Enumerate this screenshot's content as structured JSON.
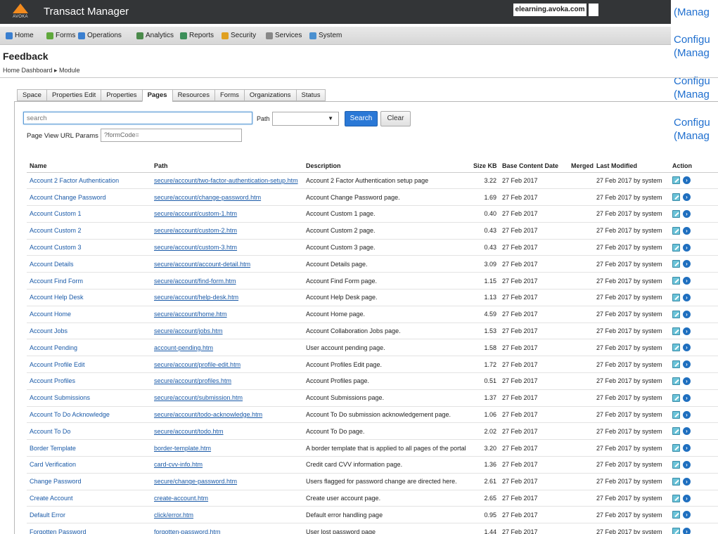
{
  "header": {
    "logo_text": "AVOKA",
    "app_title": "Transact Manager",
    "host": "elearning.avoka.com"
  },
  "menu": [
    {
      "label": "Home",
      "icon": "home-icon",
      "color": "#3a7fd0"
    },
    {
      "label": "Forms",
      "icon": "forms-icon",
      "color": "#5fa83c"
    },
    {
      "label": "Operations",
      "icon": "operations-icon",
      "color": "#3a7fd0"
    },
    {
      "label": "Analytics",
      "icon": "analytics-icon",
      "color": "#4a8a4a"
    },
    {
      "label": "Reports",
      "icon": "reports-icon",
      "color": "#3c8f5a"
    },
    {
      "label": "Security",
      "icon": "security-icon",
      "color": "#e0a020"
    },
    {
      "label": "Services",
      "icon": "services-icon",
      "color": "#888888"
    },
    {
      "label": "System",
      "icon": "system-icon",
      "color": "#4a90d0"
    }
  ],
  "side_text": [
    "(Manag",
    "Configu",
    "(Manag",
    "Configu",
    "(Manag",
    "Configu",
    "(Manag"
  ],
  "page": {
    "title": "Feedback",
    "breadcrumb": "Home Dashboard ▸ Module"
  },
  "tabs": [
    {
      "label": "Space",
      "active": false
    },
    {
      "label": "Properties Edit",
      "active": false
    },
    {
      "label": "Properties",
      "active": false
    },
    {
      "label": "Pages",
      "active": true
    },
    {
      "label": "Resources",
      "active": false
    },
    {
      "label": "Forms",
      "active": false
    },
    {
      "label": "Organizations",
      "active": false
    },
    {
      "label": "Status",
      "active": false
    }
  ],
  "search": {
    "placeholder": "search",
    "path_label": "Path",
    "path_value": "",
    "search_button": "Search",
    "clear_button": "Clear",
    "pv_label": "Page View URL Params",
    "pv_value": "?formCode="
  },
  "table": {
    "columns": [
      "Name",
      "Path",
      "Description",
      "Size KB",
      "Base Content Date",
      "Merged",
      "Last Modified",
      "Action"
    ],
    "rows": [
      {
        "name": "Account 2 Factor Authentication",
        "path": "secure/account/two-factor-authentication-setup.htm",
        "desc": "Account 2 Factor Authentication setup page",
        "size": "3.22",
        "date": "27 Feb 2017",
        "merged": "",
        "modified": "27 Feb 2017 by system"
      },
      {
        "name": "Account Change Password",
        "path": "secure/account/change-password.htm",
        "desc": "Account Change Password page.",
        "size": "1.69",
        "date": "27 Feb 2017",
        "merged": "",
        "modified": "27 Feb 2017 by system"
      },
      {
        "name": "Account Custom 1",
        "path": "secure/account/custom-1.htm",
        "desc": "Account Custom 1 page.",
        "size": "0.40",
        "date": "27 Feb 2017",
        "merged": "",
        "modified": "27 Feb 2017 by system"
      },
      {
        "name": "Account Custom 2",
        "path": "secure/account/custom-2.htm",
        "desc": "Account Custom 2 page.",
        "size": "0.43",
        "date": "27 Feb 2017",
        "merged": "",
        "modified": "27 Feb 2017 by system"
      },
      {
        "name": "Account Custom 3",
        "path": "secure/account/custom-3.htm",
        "desc": "Account Custom 3 page.",
        "size": "0.43",
        "date": "27 Feb 2017",
        "merged": "",
        "modified": "27 Feb 2017 by system"
      },
      {
        "name": "Account Details",
        "path": "secure/account/account-detail.htm",
        "desc": "Account Details page.",
        "size": "3.09",
        "date": "27 Feb 2017",
        "merged": "",
        "modified": "27 Feb 2017 by system"
      },
      {
        "name": "Account Find Form",
        "path": "secure/account/find-form.htm",
        "desc": "Account Find Form page.",
        "size": "1.15",
        "date": "27 Feb 2017",
        "merged": "",
        "modified": "27 Feb 2017 by system"
      },
      {
        "name": "Account Help Desk",
        "path": "secure/account/help-desk.htm",
        "desc": "Account Help Desk page.",
        "size": "1.13",
        "date": "27 Feb 2017",
        "merged": "",
        "modified": "27 Feb 2017 by system"
      },
      {
        "name": "Account Home",
        "path": "secure/account/home.htm",
        "desc": "Account Home page.",
        "size": "4.59",
        "date": "27 Feb 2017",
        "merged": "",
        "modified": "27 Feb 2017 by system"
      },
      {
        "name": "Account Jobs",
        "path": "secure/account/jobs.htm",
        "desc": "Account Collaboration Jobs page.",
        "size": "1.53",
        "date": "27 Feb 2017",
        "merged": "",
        "modified": "27 Feb 2017 by system"
      },
      {
        "name": "Account Pending",
        "path": "account-pending.htm",
        "desc": "User account pending page.",
        "size": "1.58",
        "date": "27 Feb 2017",
        "merged": "",
        "modified": "27 Feb 2017 by system"
      },
      {
        "name": "Account Profile Edit",
        "path": "secure/account/profile-edit.htm",
        "desc": "Account Profiles Edit page.",
        "size": "1.72",
        "date": "27 Feb 2017",
        "merged": "",
        "modified": "27 Feb 2017 by system"
      },
      {
        "name": "Account Profiles",
        "path": "secure/account/profiles.htm",
        "desc": "Account Profiles page.",
        "size": "0.51",
        "date": "27 Feb 2017",
        "merged": "",
        "modified": "27 Feb 2017 by system"
      },
      {
        "name": "Account Submissions",
        "path": "secure/account/submission.htm",
        "desc": "Account Submissions page.",
        "size": "1.37",
        "date": "27 Feb 2017",
        "merged": "",
        "modified": "27 Feb 2017 by system"
      },
      {
        "name": "Account To Do Acknowledge",
        "path": "secure/account/todo-acknowledge.htm",
        "desc": "Account To Do submission acknowledgement page.",
        "size": "1.06",
        "date": "27 Feb 2017",
        "merged": "",
        "modified": "27 Feb 2017 by system"
      },
      {
        "name": "Account To Do",
        "path": "secure/account/todo.htm",
        "desc": "Account To Do page.",
        "size": "2.02",
        "date": "27 Feb 2017",
        "merged": "",
        "modified": "27 Feb 2017 by system"
      },
      {
        "name": "Border Template",
        "path": "border-template.htm",
        "desc": "A border template that is applied to all pages of the portal",
        "size": "3.20",
        "date": "27 Feb 2017",
        "merged": "",
        "modified": "27 Feb 2017 by system"
      },
      {
        "name": "Card Verification",
        "path": "card-cvv-info.htm",
        "desc": "Credit card CVV information page.",
        "size": "1.36",
        "date": "27 Feb 2017",
        "merged": "",
        "modified": "27 Feb 2017 by system"
      },
      {
        "name": "Change Password",
        "path": "secure/change-password.htm",
        "desc": "Users flagged for password change are directed here.",
        "size": "2.61",
        "date": "27 Feb 2017",
        "merged": "",
        "modified": "27 Feb 2017 by system"
      },
      {
        "name": "Create Account",
        "path": "create-account.htm",
        "desc": "Create user account page.",
        "size": "2.65",
        "date": "27 Feb 2017",
        "merged": "",
        "modified": "27 Feb 2017 by system"
      },
      {
        "name": "Default Error",
        "path": "click/error.htm",
        "desc": "Default error handling page",
        "size": "0.95",
        "date": "27 Feb 2017",
        "merged": "",
        "modified": "27 Feb 2017 by system"
      },
      {
        "name": "Forgotten Password",
        "path": "forgotten-password.htm",
        "desc": "User lost password page",
        "size": "1.44",
        "date": "27 Feb 2017",
        "merged": "",
        "modified": "27 Feb 2017 by system"
      }
    ]
  }
}
